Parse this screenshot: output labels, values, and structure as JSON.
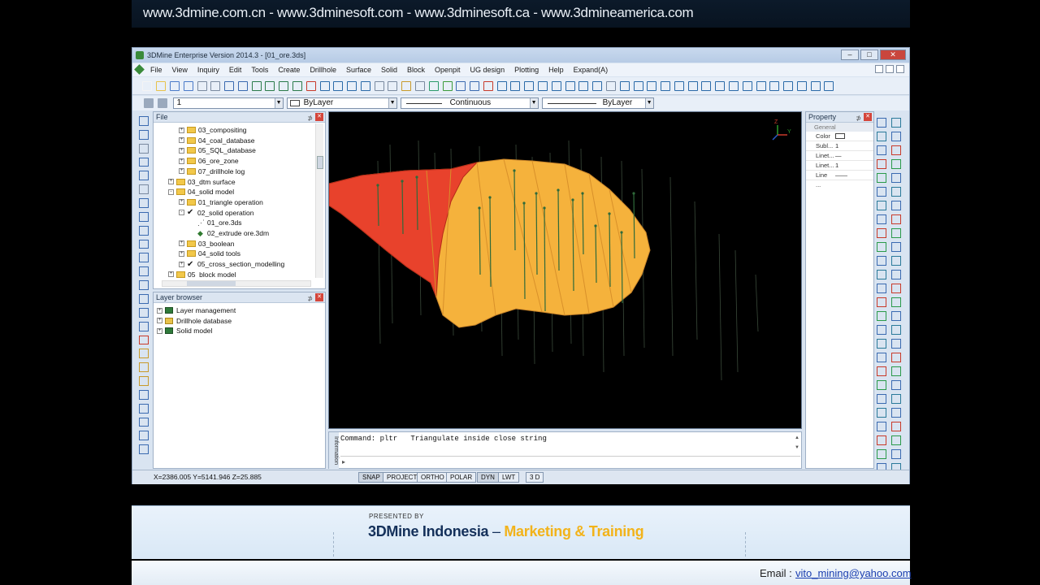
{
  "banner": {
    "text": "www.3dmine.com.cn - www.3dminesoft.com - www.3dminesoft.ca - www.3dmineamerica.com"
  },
  "window": {
    "title": "3DMine Enterprise Version 2014.3 - [01_ore.3ds]"
  },
  "menu": [
    "File",
    "View",
    "Inquiry",
    "Edit",
    "Tools",
    "Create",
    "Drillhole",
    "Surface",
    "Solid",
    "Block",
    "Openpit",
    "UG design",
    "Plotting",
    "Help",
    "Expand(A)"
  ],
  "properties_bar": {
    "layer_value": "1",
    "color_value": "ByLayer",
    "linetype_value": "Continuous",
    "lineweight_value": "ByLayer"
  },
  "file_panel": {
    "title": "File",
    "items": [
      {
        "label": "03_compositing",
        "level": 3,
        "kind": "folder",
        "expander": "+"
      },
      {
        "label": "04_coal_database",
        "level": 3,
        "kind": "folder",
        "expander": "+"
      },
      {
        "label": "05_SQL_database",
        "level": 3,
        "kind": "folder",
        "expander": "+"
      },
      {
        "label": "06_ore_zone",
        "level": 3,
        "kind": "folder",
        "expander": "+"
      },
      {
        "label": "07_drillhole log",
        "level": 3,
        "kind": "folder",
        "expander": "+"
      },
      {
        "label": "03_dtm surface",
        "level": 2,
        "kind": "folder",
        "expander": "+"
      },
      {
        "label": "04_solid model",
        "level": 2,
        "kind": "folder",
        "expander": "-"
      },
      {
        "label": "01_triangle operation",
        "level": 3,
        "kind": "folder",
        "expander": "+"
      },
      {
        "label": "02_solid operation",
        "level": 3,
        "kind": "check",
        "expander": "-"
      },
      {
        "label": "01_ore.3ds",
        "level": 4,
        "kind": "file3ds",
        "expander": ""
      },
      {
        "label": "02_extrude ore.3dm",
        "level": 4,
        "kind": "file3dm",
        "expander": ""
      },
      {
        "label": "03_boolean",
        "level": 3,
        "kind": "folder",
        "expander": "+"
      },
      {
        "label": "04_solid tools",
        "level": 3,
        "kind": "folder",
        "expander": "+"
      },
      {
        "label": "05_cross_section_modelling",
        "level": 3,
        "kind": "check",
        "expander": "+"
      },
      {
        "label": "05_block model",
        "level": 2,
        "kind": "folder",
        "expander": "+"
      }
    ]
  },
  "layer_panel": {
    "title": "Layer browser",
    "items": [
      {
        "label": "Layer management"
      },
      {
        "label": "Drillhole database"
      },
      {
        "label": "Solid model"
      }
    ]
  },
  "command": {
    "tab_label": "Information",
    "text": "Command: pltr   Triangulate inside close string",
    "prompt": "▸"
  },
  "property_panel": {
    "title": "Property",
    "group": "General",
    "rows": [
      {
        "key": "Color",
        "value": ""
      },
      {
        "key": "Subl...",
        "value": "1"
      },
      {
        "key": "Linet...",
        "value": "—"
      },
      {
        "key": "Linet...",
        "value": "1"
      },
      {
        "key": "Line ...",
        "value": "——"
      }
    ]
  },
  "status": {
    "coords": "X=2386.005 Y=5141.946 Z=25.885",
    "buttons": [
      {
        "label": "SNAP",
        "on": true
      },
      {
        "label": "PROJECT",
        "on": false
      },
      {
        "label": "ORTHO",
        "on": false
      },
      {
        "label": "POLAR",
        "on": false
      },
      {
        "label": "DYN",
        "on": true
      },
      {
        "label": "LWT",
        "on": false
      },
      {
        "label": "3 D",
        "on": false
      }
    ]
  },
  "footer": {
    "presented_by": "PRESENTED BY",
    "company": "3DMine Indonesia",
    "separator": "–",
    "tagline": "Marketing & Training",
    "email_label": "Email :",
    "email": "vito_mining@yahoo.com"
  },
  "colors": {
    "ore_red": "#e8422c",
    "ore_orange": "#f5b23c",
    "ore_yellow": "#f7c94a",
    "accent_yellow": "#f2b31b",
    "company_blue": "#14305a"
  }
}
